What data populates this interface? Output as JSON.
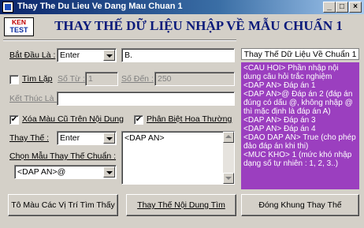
{
  "window": {
    "title": "Thay The Du Lieu Ve Dang Mau Chuan 1",
    "controls": {
      "minimize": "_",
      "maximize": "□",
      "close": "×"
    }
  },
  "logo": {
    "line1": "KEN",
    "line2": "TEST"
  },
  "banner": "THAY THẾ DỮ LIỆU NHẬP VỀ MẪU CHUẨN 1",
  "form": {
    "bat_dau_label": "Bắt Đầu Là :",
    "bat_dau_combo": "Enter",
    "bat_dau_text": "B.",
    "tim_lap_label": "Tìm Lặp",
    "tim_lap_checked": false,
    "so_tu_label": "Số Từ :",
    "so_tu_value": "1",
    "so_den_label": "Số Đến :",
    "so_den_value": "250",
    "ket_thuc_label": "Kết Thúc Là :",
    "ket_thuc_value": "",
    "xoa_mau_label": "Xóa Màu Cũ Trên Nội Dung",
    "xoa_mau_checked": true,
    "phan_biet_label": "Phân Biệt Hoa Thường",
    "phan_biet_checked": true,
    "thay_the_label": "Thay Thế :",
    "thay_the_combo": "Enter",
    "chon_mau_label": "Chọn Mẫu Thay Thế Chuẩn :",
    "chon_mau_combo": "<DAP AN>@",
    "replace_text": "<DAP AN>",
    "check_mark": "✔"
  },
  "help": {
    "title": "Thay Thế Dữ Liệu Về Chuẩn 1",
    "lines": [
      "<CAU HOI> Phần nhập nội dung câu hỏi trắc nghiệm",
      "<DAP AN> Đáp án 1",
      "<DAP AN>@ Đáp án 2 (đáp án đúng có dấu @, không nhập @ thì mặc định là đáp án A)",
      "<DAP AN> Đáp án 3",
      "<DAP AN> Đáp án 4",
      "<DAO DAP AN> True (cho phép đảo đáp án khi thi)",
      "<MUC KHO> 1 (mức khó nhập dạng số tự nhiên : 1, 2, 3..)"
    ]
  },
  "buttons": {
    "to_mau": "Tô Màu Các Vị Trí Tìm Thấy",
    "thay_the": "Thay Thế Nội Dung Tìm",
    "dong_khung": "Đóng Khung Thay Thế"
  }
}
